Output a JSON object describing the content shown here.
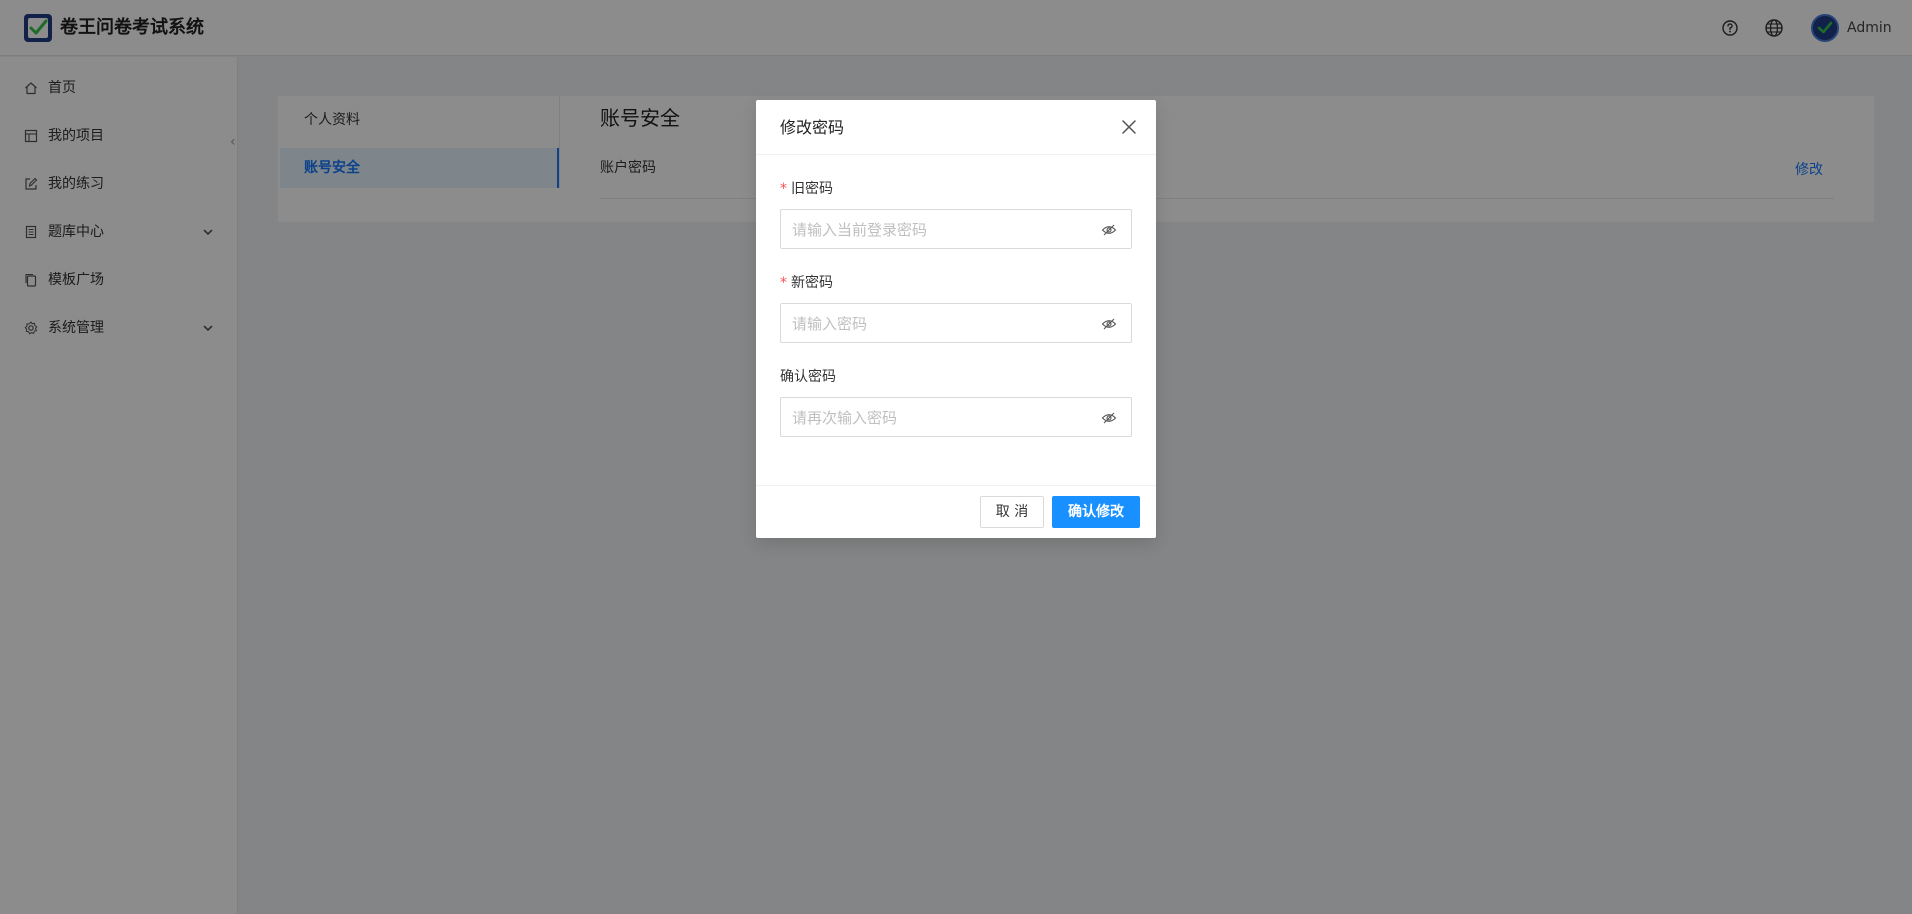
{
  "header": {
    "app_title": "卷王问卷考试系统",
    "help_icon": "help-circle-icon",
    "language_icon": "globe-icon",
    "username": "Admin"
  },
  "sidebar": {
    "items": [
      {
        "label": "首页",
        "icon": "home-icon"
      },
      {
        "label": "我的项目",
        "icon": "project-icon"
      },
      {
        "label": "我的练习",
        "icon": "edit-icon"
      },
      {
        "label": "题库中心",
        "icon": "book-icon",
        "has_submenu": true
      },
      {
        "label": "模板广场",
        "icon": "copy-icon"
      },
      {
        "label": "系统管理",
        "icon": "gear-icon",
        "has_submenu": true
      }
    ]
  },
  "settings": {
    "tabs": [
      {
        "label": "个人资料",
        "active": false
      },
      {
        "label": "账号安全",
        "active": true
      }
    ],
    "section_title": "账号安全",
    "rows": [
      {
        "label": "账户密码",
        "action": "修改"
      }
    ]
  },
  "modal": {
    "title": "修改密码",
    "fields": [
      {
        "label": "旧密码",
        "required": true,
        "placeholder": "请输入当前登录密码",
        "value": ""
      },
      {
        "label": "新密码",
        "required": true,
        "placeholder": "请输入密码",
        "value": ""
      },
      {
        "label": "确认密码",
        "required": false,
        "placeholder": "请再次输入密码",
        "value": ""
      }
    ],
    "cancel_label": "取 消",
    "ok_label": "确认修改"
  },
  "colors": {
    "primary": "#1890ff",
    "link": "#1677ff",
    "required": "#ff4d4f",
    "logo": "#1f3c88",
    "check": "#36c24c"
  }
}
